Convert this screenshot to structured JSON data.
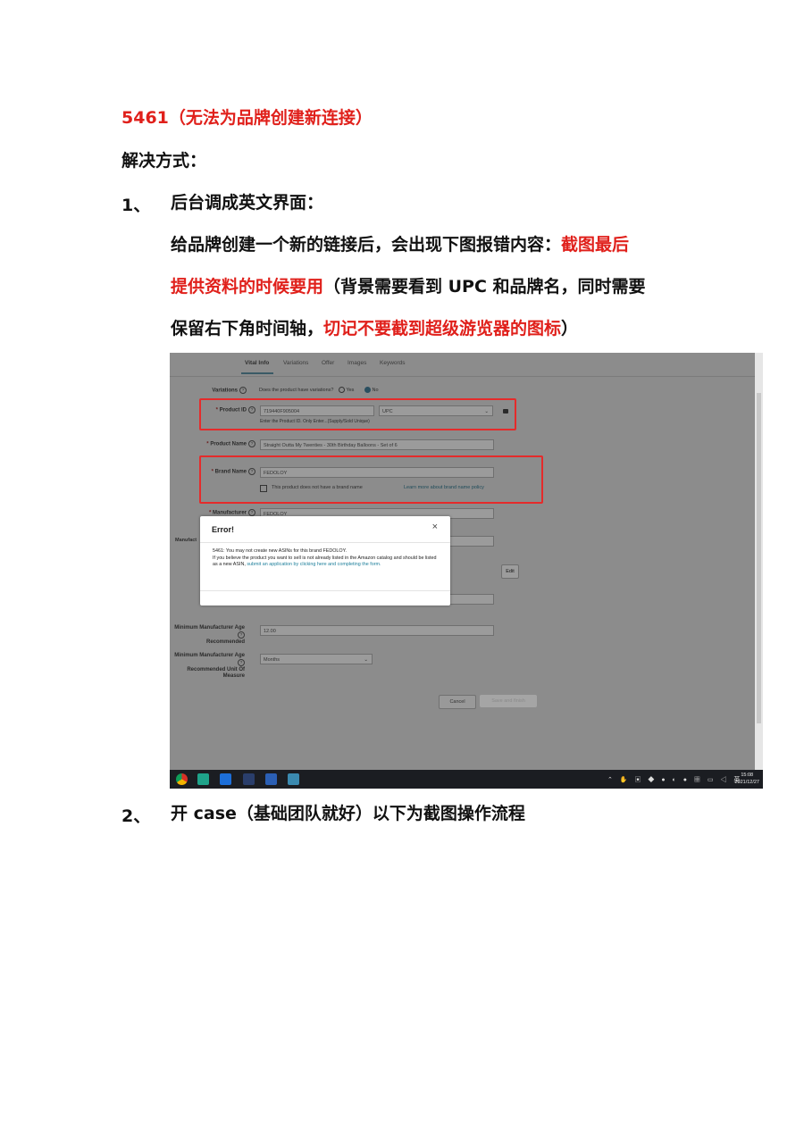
{
  "heading_code": "5461（无法为品牌创建新连接）",
  "solution_label": "解决方式：",
  "steps": [
    {
      "num": "1、",
      "text": "后台调成英文界面："
    },
    {
      "num": "2、",
      "text": "开 case（基础团队就好）以下为截图操作流程"
    }
  ],
  "para": {
    "line1_black": "给品牌创建一个新的链接后，会出现下图报错内容：",
    "line1_red": "截图最后",
    "line2_red": "提供资料的时候要用",
    "line2_black": "（背景需要看到 UPC 和品牌名，同时需要",
    "line3_black": "保留右下角时间轴，",
    "line3_red": "切记不要截到超级游览器的图标",
    "line3_end": "）"
  },
  "screenshot": {
    "tabs": [
      "Vital Info",
      "Variations",
      "Offer",
      "Images",
      "Keywords"
    ],
    "variations_label": "Variations",
    "variations_question": "Does the product have variations?",
    "radio_yes": "Yes",
    "radio_no": "No",
    "product_id_label": "Product ID",
    "product_id_value": "719440F905004",
    "product_id_type": "UPC",
    "product_id_note": "Enter the Product ID. Only Enter...(Supply/Sold Unique)",
    "product_name_label": "Product Name",
    "product_name_value": "Straight Outta My Twenties - 30th Birthday Balloons - Set of 6",
    "brand_name_label": "Brand Name",
    "brand_name_value": "FEDOLOY",
    "no_brand_text": "This product does not have a brand name",
    "brand_policy_link": "Learn more about brand name policy",
    "manufacturer_label": "Manufacturer",
    "manufacturer_value": "FEDOLOY",
    "manufacturer_partial_label": "Manufact",
    "edit_button": "Edit",
    "min_age_label_1": "Minimum Manufacturer Age",
    "min_age_label_2": "Recommended",
    "min_age_value": "12.00",
    "min_age_unit_label_1": "Minimum Manufacturer Age",
    "min_age_unit_label_2": "Recommended Unit Of Measure",
    "min_age_unit_value": "Months",
    "cancel_button": "Cancel",
    "save_button": "Save and finish",
    "dialog": {
      "title": "Error!",
      "close": "×",
      "line1": "5461: You may not create new ASINs for this brand FEDOLOY.",
      "line2": "If you believe the product you want to sell is not already listed in the Amazon catalog and should be listed as a new ASIN, ",
      "link": "submit an application by clicking here and completing the form."
    },
    "taskbar": {
      "tray_lang": "英",
      "time": "15:08",
      "date": "2021/12/27"
    }
  },
  "colors": {
    "highlight_red": "#e0201b",
    "annotation_box": "#e52b2b",
    "link": "#1d7f9b"
  }
}
